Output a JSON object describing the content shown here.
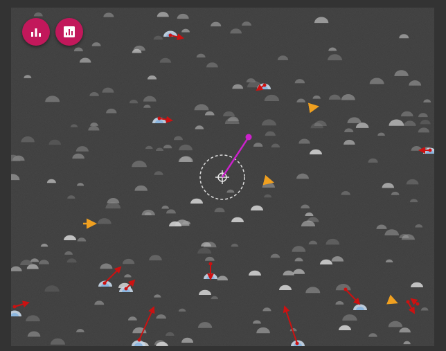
{
  "toolbar": {
    "buttons": [
      {
        "name": "chart-button",
        "icon": "bar-chart-icon"
      },
      {
        "name": "report-button",
        "icon": "report-chart-icon"
      }
    ]
  },
  "colors": {
    "background": "#3a3a3a",
    "page": "#333333",
    "fab": "#c2185b",
    "vector_red": "#cc1111",
    "vector_orange": "#f0a020",
    "vector_magenta": "#cc22cc",
    "selection_ring": "#dddddd",
    "cell_highlight": "#7fb0e0"
  }
}
